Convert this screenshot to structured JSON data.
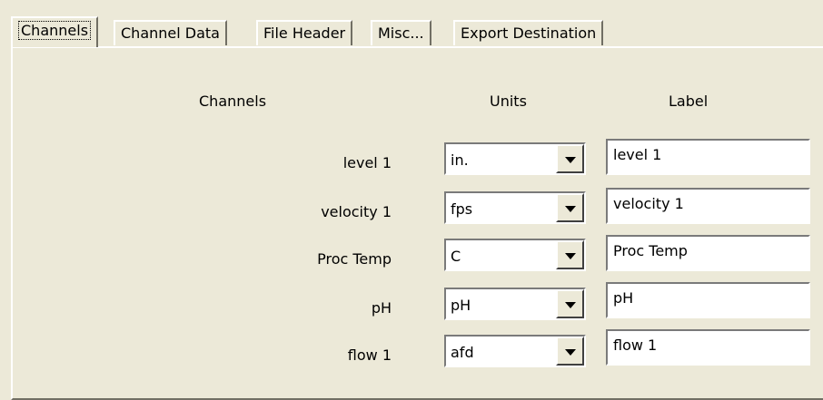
{
  "tabs": [
    {
      "label": "Channels",
      "active": true
    },
    {
      "label": "Channel Data",
      "active": false
    },
    {
      "label": "File Header",
      "active": false
    },
    {
      "label": "Misc...",
      "active": false
    },
    {
      "label": "Export Destination",
      "active": false
    }
  ],
  "headers": {
    "channels": "Channels",
    "units": "Units",
    "label": "Label"
  },
  "rows": [
    {
      "channel": "level 1",
      "unit": "in.",
      "label": "level 1"
    },
    {
      "channel": "velocity 1",
      "unit": "fps",
      "label": "velocity 1"
    },
    {
      "channel": "Proc Temp",
      "unit": "C",
      "label": "Proc Temp"
    },
    {
      "channel": "pH",
      "unit": "pH",
      "label": "pH"
    },
    {
      "channel": "flow 1",
      "unit": "afd",
      "label": "flow 1"
    }
  ],
  "icons": {
    "dropdown": "chevron-down-icon"
  }
}
